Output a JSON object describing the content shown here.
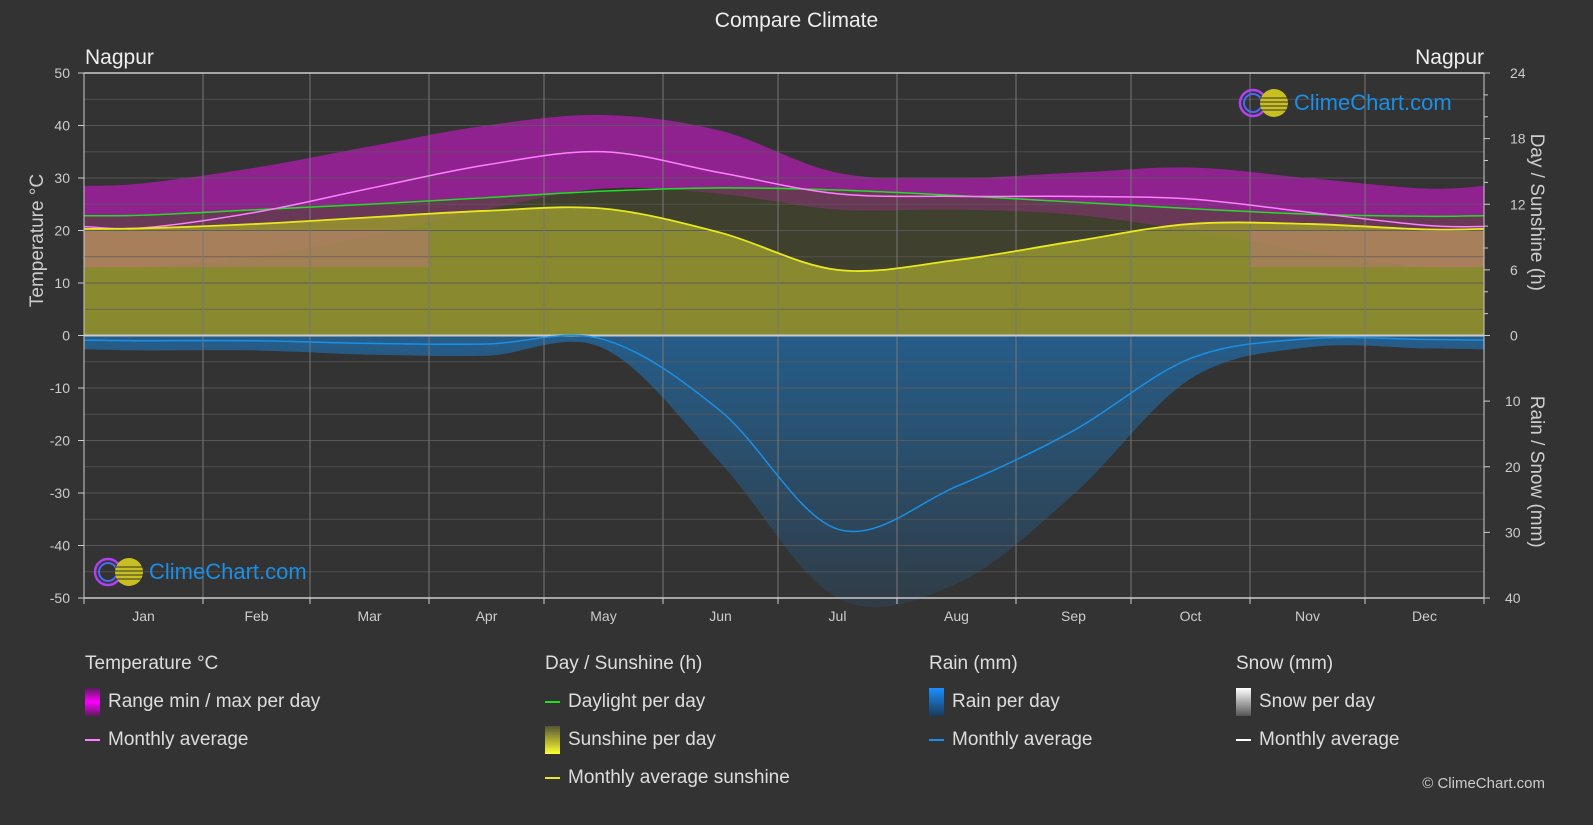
{
  "title": "Compare Climate",
  "city_left": "Nagpur",
  "city_right": "Nagpur",
  "watermark": "ClimeChart.com",
  "copyright": "© ClimeChart.com",
  "colors": {
    "background": "#333333",
    "temp_range": "#cc22cc",
    "temp_avg": "#ff80ff",
    "daylight": "#22dd22",
    "sunshine_fill": "#b8b832",
    "sunshine_avg": "#e8e820",
    "rain": "#1a7fd0",
    "rain_avg": "#1a8fe6",
    "snow_avg": "#ffffff",
    "grid": "#5a5a5a"
  },
  "legend": {
    "temperature": {
      "header": "Temperature °C",
      "items": [
        "Range min / max per day",
        "Monthly average"
      ]
    },
    "sunshine": {
      "header": "Day / Sunshine (h)",
      "items": [
        "Daylight per day",
        "Sunshine per day",
        "Monthly average sunshine"
      ]
    },
    "rain": {
      "header": "Rain (mm)",
      "items": [
        "Rain per day",
        "Monthly average"
      ]
    },
    "snow": {
      "header": "Snow (mm)",
      "items": [
        "Snow per day",
        "Monthly average"
      ]
    }
  },
  "chart_data": {
    "type": "line",
    "title": "Compare Climate",
    "categories": [
      "Jan",
      "Feb",
      "Mar",
      "Apr",
      "May",
      "Jun",
      "Jul",
      "Aug",
      "Sep",
      "Oct",
      "Nov",
      "Dec"
    ],
    "left_axis": {
      "label": "Temperature °C",
      "range": [
        -50,
        50
      ],
      "ticks": [
        50,
        40,
        30,
        20,
        10,
        0,
        -10,
        -20,
        -30,
        -40,
        -50
      ]
    },
    "right_axis_top": {
      "label": "Day / Sunshine (h)",
      "range": [
        0,
        24
      ],
      "ticks": [
        24,
        18,
        12,
        6,
        0
      ]
    },
    "right_axis_bottom": {
      "label": "Rain / Snow (mm)",
      "range": [
        0,
        40
      ],
      "ticks": [
        0,
        10,
        20,
        30,
        40
      ]
    },
    "grid": true,
    "series": [
      {
        "name": "Temperature monthly average",
        "axis": "temp",
        "values": [
          20.5,
          23.5,
          28,
          32.5,
          35,
          31,
          27,
          26.5,
          26.5,
          26,
          23.5,
          21
        ]
      },
      {
        "name": "Temperature daily max (approx)",
        "axis": "temp",
        "values": [
          29,
          32,
          36,
          40,
          42,
          39,
          31,
          30,
          31,
          32,
          30,
          28
        ]
      },
      {
        "name": "Temperature daily min (approx)",
        "axis": "temp",
        "values": [
          13,
          15,
          19,
          24,
          28,
          27,
          24,
          24,
          23,
          20,
          16,
          13
        ]
      },
      {
        "name": "Daylight per day",
        "axis": "hours",
        "values": [
          11.0,
          11.5,
          12.0,
          12.6,
          13.2,
          13.5,
          13.3,
          12.8,
          12.2,
          11.6,
          11.1,
          10.9
        ]
      },
      {
        "name": "Monthly average sunshine",
        "axis": "hours",
        "values": [
          9.8,
          10.2,
          10.8,
          11.4,
          11.6,
          9.4,
          6.0,
          6.9,
          8.6,
          10.2,
          10.2,
          9.7
        ]
      },
      {
        "name": "Rain monthly average",
        "axis": "mm",
        "values": [
          0.8,
          0.8,
          1.2,
          1.3,
          0.6,
          11.5,
          29.5,
          23.0,
          14.5,
          3.5,
          0.5,
          0.6
        ]
      },
      {
        "name": "Snow monthly average",
        "axis": "mm",
        "values": [
          0,
          0,
          0,
          0,
          0,
          0,
          0,
          0,
          0,
          0,
          0,
          0
        ]
      }
    ]
  }
}
